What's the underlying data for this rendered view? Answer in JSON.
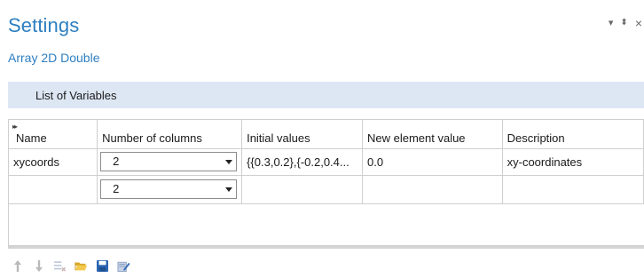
{
  "header": {
    "title": "Settings",
    "subtitle": "Array 2D Double"
  },
  "window_controls": {
    "dropdown_glyph": "▾",
    "pin_glyph": "⬍",
    "close_glyph": "×"
  },
  "section": {
    "label": "List of Variables"
  },
  "table": {
    "columns": [
      "Name",
      "Number of columns",
      "Initial values",
      "New element value",
      "Description"
    ],
    "rows": [
      {
        "name": "xycoords",
        "num_columns": "2",
        "initial_values": "{{0.3,0.2},{-0.2,0.4...",
        "new_element_value": "0.0",
        "description": "xy-coordinates"
      },
      {
        "name": "",
        "num_columns": "2",
        "initial_values": "",
        "new_element_value": "",
        "description": ""
      }
    ]
  },
  "toolbar": {
    "icons": [
      "move-up-icon",
      "move-down-icon",
      "delete-icon",
      "open-folder-icon",
      "save-icon",
      "edit-icon"
    ]
  },
  "colors": {
    "accent": "#2e7fc1",
    "section_bar": "#dde7f4",
    "grid_line": "#cfcfcf"
  }
}
